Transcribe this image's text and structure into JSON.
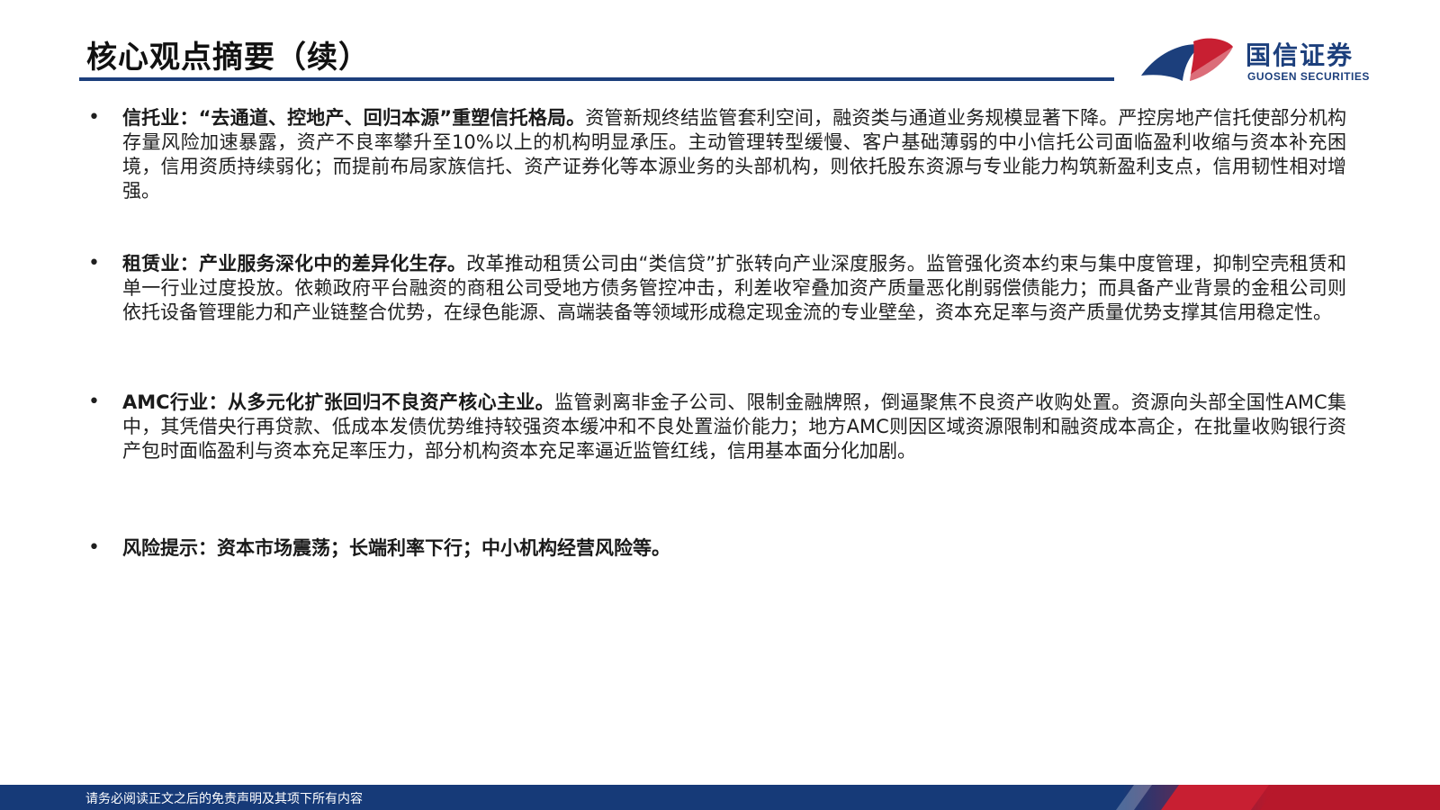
{
  "header": {
    "title": "核心观点摘要（续）",
    "logo_cn": "国信证券",
    "logo_en": "GUOSEN SECURITIES"
  },
  "items": [
    {
      "lead": "信托业：“去通道、控地产、回归本源”重塑信托格局。",
      "body": "资管新规终结监管套利空间，融资类与通道业务规模显著下降。严控房地产信托使部分机构存量风险加速暴露，资产不良率攀升至10%以上的机构明显承压。主动管理转型缓慢、客户基础薄弱的中小信托公司面临盈利收缩与资本补充困境，信用资质持续弱化；而提前布局家族信托、资产证券化等本源业务的头部机构，则依托股东资源与专业能力构筑新盈利支点，信用韧性相对增强。"
    },
    {
      "lead": "租赁业：产业服务深化中的差异化生存。",
      "body": "改革推动租赁公司由“类信贷”扩张转向产业深度服务。监管强化资本约束与集中度管理，抑制空壳租赁和单一行业过度投放。依赖政府平台融资的商租公司受地方债务管控冲击，利差收窄叠加资产质量恶化削弱偿债能力；而具备产业背景的金租公司则依托设备管理能力和产业链整合优势，在绿色能源、高端装备等领域形成稳定现金流的专业壁垒，资本充足率与资产质量优势支撑其信用稳定性。"
    },
    {
      "lead": "AMC行业：从多元化扩张回归不良资产核心主业。",
      "body": "监管剥离非金子公司、限制金融牌照，倒逼聚焦不良资产收购处置。资源向头部全国性AMC集中，其凭借央行再贷款、低成本发债优势维持较强资本缓冲和不良处置溢价能力；地方AMC则因区域资源限制和融资成本高企，在批量收购银行资产包时面临盈利与资本充足率压力，部分机构资本充足率逼近监管红线，信用基本面分化加剧。"
    },
    {
      "lead": "风险提示：资本市场震荡；长端利率下行；中小机构经营风险等。",
      "body": ""
    }
  ],
  "footer": {
    "disclaimer": "请务必阅读正文之后的免责声明及其项下所有内容"
  },
  "colors": {
    "brand_blue": "#1c3f7c",
    "brand_red": "#c81f32"
  },
  "icons": {
    "bullet": "bullet-dot",
    "logo": "guosen-logo-icon"
  }
}
